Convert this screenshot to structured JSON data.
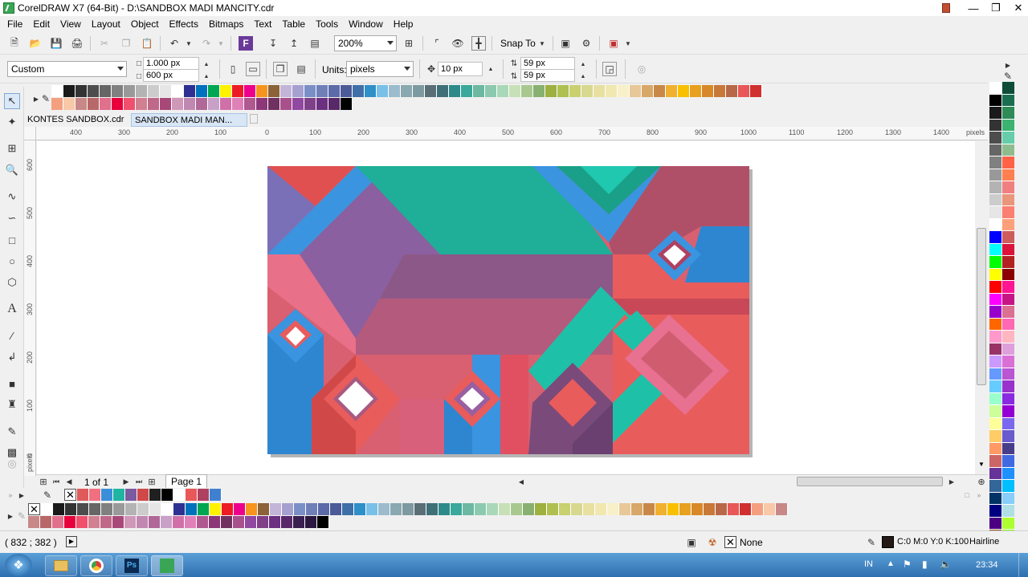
{
  "app": {
    "title": "CorelDRAW X7 (64-Bit) - D:\\SANDBOX MADI MANCITY.cdr"
  },
  "menu": [
    "File",
    "Edit",
    "View",
    "Layout",
    "Object",
    "Effects",
    "Bitmaps",
    "Text",
    "Table",
    "Tools",
    "Window",
    "Help"
  ],
  "toolbar": {
    "zoom": "200%",
    "snap_to": "Snap To"
  },
  "property_bar": {
    "page_preset": "Custom",
    "width": "1.000 px",
    "height": "600 px",
    "units_label": "Units:",
    "units_value": "pixels",
    "nudge": "10 px",
    "dup_x": "59 px",
    "dup_y": "59 px"
  },
  "doc_tabs": [
    "KONTES SANDBOX.cdr",
    "SANDBOX MADI MAN..."
  ],
  "ruler": {
    "h_ticks": [
      "400",
      "300",
      "200",
      "100",
      "0",
      "100",
      "200",
      "300",
      "400",
      "500",
      "600",
      "700",
      "800",
      "900",
      "1000",
      "1100",
      "1200",
      "1300",
      "1400"
    ],
    "h_unit": "pixels",
    "v_ticks": [
      "600",
      "500",
      "400",
      "300",
      "200",
      "100",
      "0"
    ],
    "v_unit": "pixels"
  },
  "page_nav": {
    "count": "1 of 1",
    "page_tab": "Page 1"
  },
  "status": {
    "coords": "( 832 ; 382  )",
    "fill": "None",
    "outline_color": "C:0 M:0 Y:0 K:100",
    "outline_width": "Hairline"
  },
  "taskbar": {
    "lang": "IN",
    "time": "23:34"
  },
  "palette_top_row1": [
    "#ffffff",
    "#1a1a1a",
    "#333333",
    "#4d4d4d",
    "#666666",
    "#808080",
    "#999999",
    "#b3b3b3",
    "#cccccc",
    "#e6e6e6",
    "#ffffff",
    "#2e3192",
    "#0071bc",
    "#00a651",
    "#fff200",
    "#ed1c24",
    "#ec008c",
    "#f7941d",
    "#8c6239",
    "#c2b5d8",
    "#a5a0d0",
    "#7b8fc7",
    "#6f7fb8",
    "#5b6aa8",
    "#4b5a98",
    "#3f6fa8",
    "#2f8fc8",
    "#79c0e8",
    "#9bbccc",
    "#8aa8b0",
    "#7d9aa0",
    "#5a6e76",
    "#3f7078",
    "#2e8a8a",
    "#3aa89a",
    "#6cb8a0",
    "#8ccab0",
    "#a8d8b8",
    "#c8e0b8",
    "#a8c890",
    "#88b070",
    "#9db040",
    "#b0c050",
    "#c8d070",
    "#d8d890",
    "#e8e0a0",
    "#f0e8b0",
    "#f8f0c8",
    "#e8c898",
    "#d8a868",
    "#c88848",
    "#f0b030",
    "#f8c000",
    "#e8a020",
    "#d88828",
    "#c87838",
    "#b86848",
    "#e85858",
    "#d03030"
  ],
  "palette_top_row2": [
    "#f4a080",
    "#f8c8a8",
    "#c88888",
    "#b86868",
    "#e0708c",
    "#e8003c",
    "#f0506c",
    "#d08090",
    "#c06888",
    "#a84878",
    "#d098b8",
    "#c088b0",
    "#b06898",
    "#c8a0c8",
    "#d070a8",
    "#e080b8",
    "#b05890",
    "#8c3878",
    "#703060",
    "#a8508c",
    "#9048a0",
    "#804088",
    "#6c3080",
    "#582868",
    "#000000"
  ],
  "palette_right": [
    "#ffffff",
    "#000000",
    "#1a1a1a",
    "#333333",
    "#4d4d4d",
    "#666666",
    "#808080",
    "#999999",
    "#b3b3b3",
    "#cccccc",
    "#e6e6e6",
    "#ffffff",
    "#0000ff",
    "#00ffff",
    "#00ff00",
    "#ffff00",
    "#ff0000",
    "#ff00ff",
    "#9900cc",
    "#ff6600",
    "#ff99cc",
    "#993366",
    "#cc99ff",
    "#6699ff",
    "#66ccff",
    "#99ffcc",
    "#ccff99",
    "#ffff99",
    "#ffcc66",
    "#ff9966",
    "#cc6666",
    "#663399",
    "#336699",
    "#003366",
    "#000080",
    "#4b0082",
    "#8b4513",
    "#66cdaa",
    "#20b2aa",
    "#2e8b57"
  ],
  "palette_right2": [
    "#0f4d3a",
    "#1a6e50",
    "#2e8b57",
    "#3cb371",
    "#66cdaa",
    "#8fbc8f",
    "#ff6347",
    "#ff7f50",
    "#f08080",
    "#e9967a",
    "#fa8072",
    "#ffa07a",
    "#cd5c5c",
    "#dc143c",
    "#b22222",
    "#8b0000",
    "#ff1493",
    "#c71585",
    "#db7093",
    "#ff69b4",
    "#ffb6c1",
    "#dda0dd",
    "#da70d6",
    "#ba55d3",
    "#9932cc",
    "#8a2be2",
    "#9400d3",
    "#7b68ee",
    "#6a5acd",
    "#483d8b",
    "#4169e1",
    "#1e90ff",
    "#00bfff",
    "#87cefa",
    "#b0e0e6",
    "#adff2f",
    "#7fff00",
    "#32cd32",
    "#228b22",
    "#006400"
  ],
  "doc_palette": [
    "#e05a5a",
    "#f07080",
    "#3a8fd8",
    "#1fb5a0",
    "#7a5aa0",
    "#d04848",
    "#202020",
    "#000000",
    "#ffffff",
    "#e85858",
    "#b04060",
    "#4080d0"
  ],
  "palette_bottom_row1": [
    "#ffffff",
    "#1a1a1a",
    "#333333",
    "#4d4d4d",
    "#666666",
    "#808080",
    "#999999",
    "#b3b3b3",
    "#cccccc",
    "#e6e6e6",
    "#ffffff",
    "#2e3192",
    "#0071bc",
    "#00a651",
    "#fff200",
    "#ed1c24",
    "#ec008c",
    "#f7941d",
    "#8c6239",
    "#c2b5d8",
    "#a5a0d0",
    "#7b8fc7",
    "#6f7fb8",
    "#5b6aa8",
    "#4b5a98",
    "#3f6fa8",
    "#2f8fc8",
    "#79c0e8",
    "#9bbccc",
    "#8aa8b0",
    "#7d9aa0",
    "#5a6e76",
    "#3f7078",
    "#2e8a8a",
    "#3aa89a",
    "#6cb8a0",
    "#8ccab0",
    "#a8d8b8",
    "#c8e0b8",
    "#a8c890",
    "#88b070",
    "#9db040",
    "#b0c050",
    "#c8d070",
    "#d8d890",
    "#e8e0a0",
    "#f0e8b0",
    "#f8f0c8",
    "#e8c898",
    "#d8a868",
    "#c88848",
    "#f0b030",
    "#f8c000",
    "#e8a020",
    "#d88828",
    "#c87838",
    "#b86848",
    "#e85858",
    "#d03030",
    "#f4a080",
    "#f8c8a8",
    "#c88888"
  ],
  "palette_bottom_row2": [
    "#c88888",
    "#b86868",
    "#e0708c",
    "#e8003c",
    "#f0506c",
    "#d08090",
    "#c06888",
    "#a84878",
    "#d098b8",
    "#c088b0",
    "#b06898",
    "#c8a0c8",
    "#d070a8",
    "#e080b8",
    "#b05890",
    "#8c3878",
    "#703060",
    "#a8508c",
    "#9048a0",
    "#804088",
    "#6c3080",
    "#582868",
    "#3a2050",
    "#2a1840",
    "#000000"
  ],
  "colors": {
    "art_blue": "#3a8fd8",
    "art_teal": "#1fb5a0",
    "art_coral": "#e85858",
    "art_purple": "#8a5a98",
    "art_pink": "#e8707c"
  }
}
